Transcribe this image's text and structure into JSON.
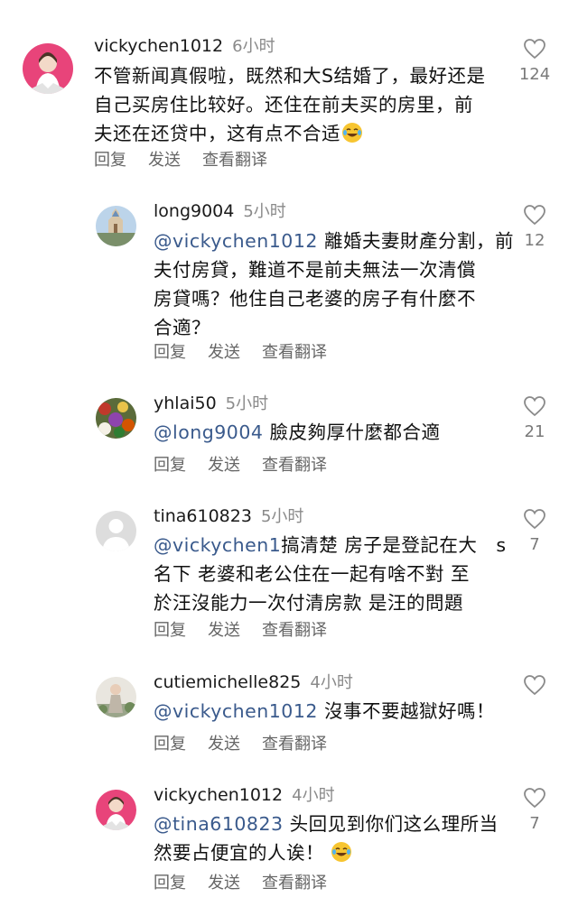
{
  "comments": [
    {
      "username": "vickychen1012",
      "time": "6小时",
      "lines": [
        "不管新闻真假啦，既然和大S结婚了，最好还是",
        "自己买房住比较好。还住在前夫买的房里，前",
        "夫还在还贷中，这有点不合适"
      ],
      "emoji_after_last_line": "laughing-crying-emoji",
      "likes": "124"
    },
    {
      "username": "long9004",
      "time": "5小时",
      "mention": "@vickychen1012",
      "lines": [
        " 離婚夫妻財產分割，前",
        "夫付房貸，難道不是前夫無法一次清償",
        "房貸嗎？他住自己老婆的房子有什麼不",
        "合適？"
      ],
      "likes": "12"
    },
    {
      "username": "yhlai50",
      "time": "5小时",
      "mention": "@long9004",
      "lines": [
        " 臉皮夠厚什麼都合適"
      ],
      "likes": "21"
    },
    {
      "username": "tina610823",
      "time": "5小时",
      "mention": "@vickychen1",
      "lines": [
        "搞清楚 房子是登記在大　s",
        "名下 老婆和老公住在一起有啥不對 至",
        "於汪沒能力一次付清房款 是汪的問題"
      ],
      "likes": "7"
    },
    {
      "username": "cutiemichelle825",
      "time": "4小时",
      "mention": "@vickychen1012",
      "lines": [
        " 沒事不要越獄好嗎！"
      ],
      "likes": ""
    },
    {
      "username": "vickychen1012",
      "time": "4小时",
      "mention": "@tina610823",
      "lines": [
        " 头回见到你们这么理所当",
        "然要占便宜的人诶！"
      ],
      "emoji_after_last_line": "laughing-crying-emoji",
      "likes": "7"
    }
  ],
  "actions": {
    "reply": "回复",
    "send": "发送",
    "translate": "查看翻译"
  }
}
